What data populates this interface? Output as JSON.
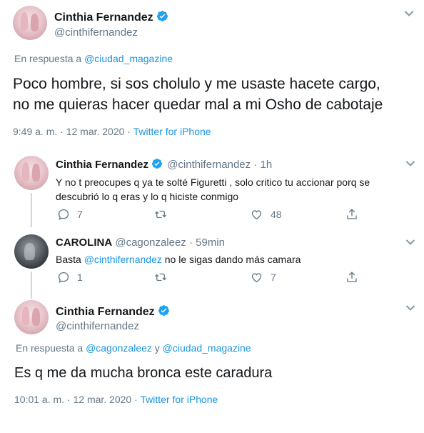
{
  "tweet1": {
    "display_name": "Cinthia Fernandez",
    "handle": "@cinthifernandez",
    "reply_prefix": "En respuesta a",
    "reply_to": "@ciudad_magazine",
    "text_line1": "Poco hombre, si sos cholulo y me usaste hacete cargo,",
    "text_line2": "no me quieras hacer quedar mal a mi Osho de cabotaje",
    "time": "9:49 a. m. · 12 mar. 2020 ·",
    "source": "Twitter for iPhone"
  },
  "reply1": {
    "display_name": "Cinthia Fernandez",
    "handle": "@cinthifernandez · 1h",
    "text_line1": "Y no t preocupes q ya te solté Figuretti , solo critico tu accionar porq se",
    "text_line2": "descubrió lo q eras y lo q hiciste conmigo",
    "replies": "7",
    "retweets": "",
    "likes": "48"
  },
  "reply2": {
    "display_name": "CAROLINA",
    "handle": "@cagonzaleez · 59min",
    "text_prefix": "Basta",
    "mention": "@cinthifernandez",
    "text_suffix": "no le sigas dando más camara",
    "replies": "1",
    "retweets": "",
    "likes": "7"
  },
  "tweet2": {
    "display_name": "Cinthia Fernandez",
    "handle": "@cinthifernandez",
    "reply_prefix": "En respuesta a",
    "reply_to_1": "@cagonzaleez",
    "reply_joiner": "y",
    "reply_to_2": "@ciudad_magazine",
    "text": "Es q me da mucha bronca este caradura",
    "time": "10:01 a. m. · 12 mar. 2020 ·",
    "source": "Twitter for iPhone"
  },
  "colors": {
    "accent": "#1b95e0",
    "muted": "#657786",
    "text": "#14171a",
    "like_red": "#e0245e"
  }
}
